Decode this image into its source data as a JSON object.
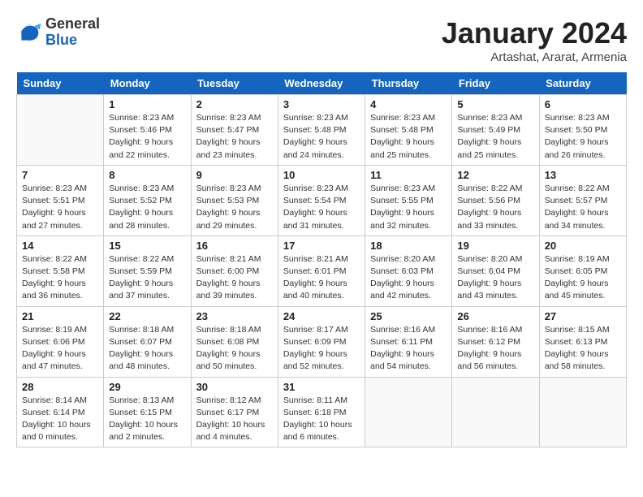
{
  "logo": {
    "general": "General",
    "blue": "Blue"
  },
  "header": {
    "month_year": "January 2024",
    "location": "Artashat, Ararat, Armenia"
  },
  "weekdays": [
    "Sunday",
    "Monday",
    "Tuesday",
    "Wednesday",
    "Thursday",
    "Friday",
    "Saturday"
  ],
  "weeks": [
    [
      {
        "day": "",
        "sunrise": "",
        "sunset": "",
        "daylight": ""
      },
      {
        "day": "1",
        "sunrise": "Sunrise: 8:23 AM",
        "sunset": "Sunset: 5:46 PM",
        "daylight": "Daylight: 9 hours and 22 minutes."
      },
      {
        "day": "2",
        "sunrise": "Sunrise: 8:23 AM",
        "sunset": "Sunset: 5:47 PM",
        "daylight": "Daylight: 9 hours and 23 minutes."
      },
      {
        "day": "3",
        "sunrise": "Sunrise: 8:23 AM",
        "sunset": "Sunset: 5:48 PM",
        "daylight": "Daylight: 9 hours and 24 minutes."
      },
      {
        "day": "4",
        "sunrise": "Sunrise: 8:23 AM",
        "sunset": "Sunset: 5:48 PM",
        "daylight": "Daylight: 9 hours and 25 minutes."
      },
      {
        "day": "5",
        "sunrise": "Sunrise: 8:23 AM",
        "sunset": "Sunset: 5:49 PM",
        "daylight": "Daylight: 9 hours and 25 minutes."
      },
      {
        "day": "6",
        "sunrise": "Sunrise: 8:23 AM",
        "sunset": "Sunset: 5:50 PM",
        "daylight": "Daylight: 9 hours and 26 minutes."
      }
    ],
    [
      {
        "day": "7",
        "sunrise": "Sunrise: 8:23 AM",
        "sunset": "Sunset: 5:51 PM",
        "daylight": "Daylight: 9 hours and 27 minutes."
      },
      {
        "day": "8",
        "sunrise": "Sunrise: 8:23 AM",
        "sunset": "Sunset: 5:52 PM",
        "daylight": "Daylight: 9 hours and 28 minutes."
      },
      {
        "day": "9",
        "sunrise": "Sunrise: 8:23 AM",
        "sunset": "Sunset: 5:53 PM",
        "daylight": "Daylight: 9 hours and 29 minutes."
      },
      {
        "day": "10",
        "sunrise": "Sunrise: 8:23 AM",
        "sunset": "Sunset: 5:54 PM",
        "daylight": "Daylight: 9 hours and 31 minutes."
      },
      {
        "day": "11",
        "sunrise": "Sunrise: 8:23 AM",
        "sunset": "Sunset: 5:55 PM",
        "daylight": "Daylight: 9 hours and 32 minutes."
      },
      {
        "day": "12",
        "sunrise": "Sunrise: 8:22 AM",
        "sunset": "Sunset: 5:56 PM",
        "daylight": "Daylight: 9 hours and 33 minutes."
      },
      {
        "day": "13",
        "sunrise": "Sunrise: 8:22 AM",
        "sunset": "Sunset: 5:57 PM",
        "daylight": "Daylight: 9 hours and 34 minutes."
      }
    ],
    [
      {
        "day": "14",
        "sunrise": "Sunrise: 8:22 AM",
        "sunset": "Sunset: 5:58 PM",
        "daylight": "Daylight: 9 hours and 36 minutes."
      },
      {
        "day": "15",
        "sunrise": "Sunrise: 8:22 AM",
        "sunset": "Sunset: 5:59 PM",
        "daylight": "Daylight: 9 hours and 37 minutes."
      },
      {
        "day": "16",
        "sunrise": "Sunrise: 8:21 AM",
        "sunset": "Sunset: 6:00 PM",
        "daylight": "Daylight: 9 hours and 39 minutes."
      },
      {
        "day": "17",
        "sunrise": "Sunrise: 8:21 AM",
        "sunset": "Sunset: 6:01 PM",
        "daylight": "Daylight: 9 hours and 40 minutes."
      },
      {
        "day": "18",
        "sunrise": "Sunrise: 8:20 AM",
        "sunset": "Sunset: 6:03 PM",
        "daylight": "Daylight: 9 hours and 42 minutes."
      },
      {
        "day": "19",
        "sunrise": "Sunrise: 8:20 AM",
        "sunset": "Sunset: 6:04 PM",
        "daylight": "Daylight: 9 hours and 43 minutes."
      },
      {
        "day": "20",
        "sunrise": "Sunrise: 8:19 AM",
        "sunset": "Sunset: 6:05 PM",
        "daylight": "Daylight: 9 hours and 45 minutes."
      }
    ],
    [
      {
        "day": "21",
        "sunrise": "Sunrise: 8:19 AM",
        "sunset": "Sunset: 6:06 PM",
        "daylight": "Daylight: 9 hours and 47 minutes."
      },
      {
        "day": "22",
        "sunrise": "Sunrise: 8:18 AM",
        "sunset": "Sunset: 6:07 PM",
        "daylight": "Daylight: 9 hours and 48 minutes."
      },
      {
        "day": "23",
        "sunrise": "Sunrise: 8:18 AM",
        "sunset": "Sunset: 6:08 PM",
        "daylight": "Daylight: 9 hours and 50 minutes."
      },
      {
        "day": "24",
        "sunrise": "Sunrise: 8:17 AM",
        "sunset": "Sunset: 6:09 PM",
        "daylight": "Daylight: 9 hours and 52 minutes."
      },
      {
        "day": "25",
        "sunrise": "Sunrise: 8:16 AM",
        "sunset": "Sunset: 6:11 PM",
        "daylight": "Daylight: 9 hours and 54 minutes."
      },
      {
        "day": "26",
        "sunrise": "Sunrise: 8:16 AM",
        "sunset": "Sunset: 6:12 PM",
        "daylight": "Daylight: 9 hours and 56 minutes."
      },
      {
        "day": "27",
        "sunrise": "Sunrise: 8:15 AM",
        "sunset": "Sunset: 6:13 PM",
        "daylight": "Daylight: 9 hours and 58 minutes."
      }
    ],
    [
      {
        "day": "28",
        "sunrise": "Sunrise: 8:14 AM",
        "sunset": "Sunset: 6:14 PM",
        "daylight": "Daylight: 10 hours and 0 minutes."
      },
      {
        "day": "29",
        "sunrise": "Sunrise: 8:13 AM",
        "sunset": "Sunset: 6:15 PM",
        "daylight": "Daylight: 10 hours and 2 minutes."
      },
      {
        "day": "30",
        "sunrise": "Sunrise: 8:12 AM",
        "sunset": "Sunset: 6:17 PM",
        "daylight": "Daylight: 10 hours and 4 minutes."
      },
      {
        "day": "31",
        "sunrise": "Sunrise: 8:11 AM",
        "sunset": "Sunset: 6:18 PM",
        "daylight": "Daylight: 10 hours and 6 minutes."
      },
      {
        "day": "",
        "sunrise": "",
        "sunset": "",
        "daylight": ""
      },
      {
        "day": "",
        "sunrise": "",
        "sunset": "",
        "daylight": ""
      },
      {
        "day": "",
        "sunrise": "",
        "sunset": "",
        "daylight": ""
      }
    ]
  ]
}
